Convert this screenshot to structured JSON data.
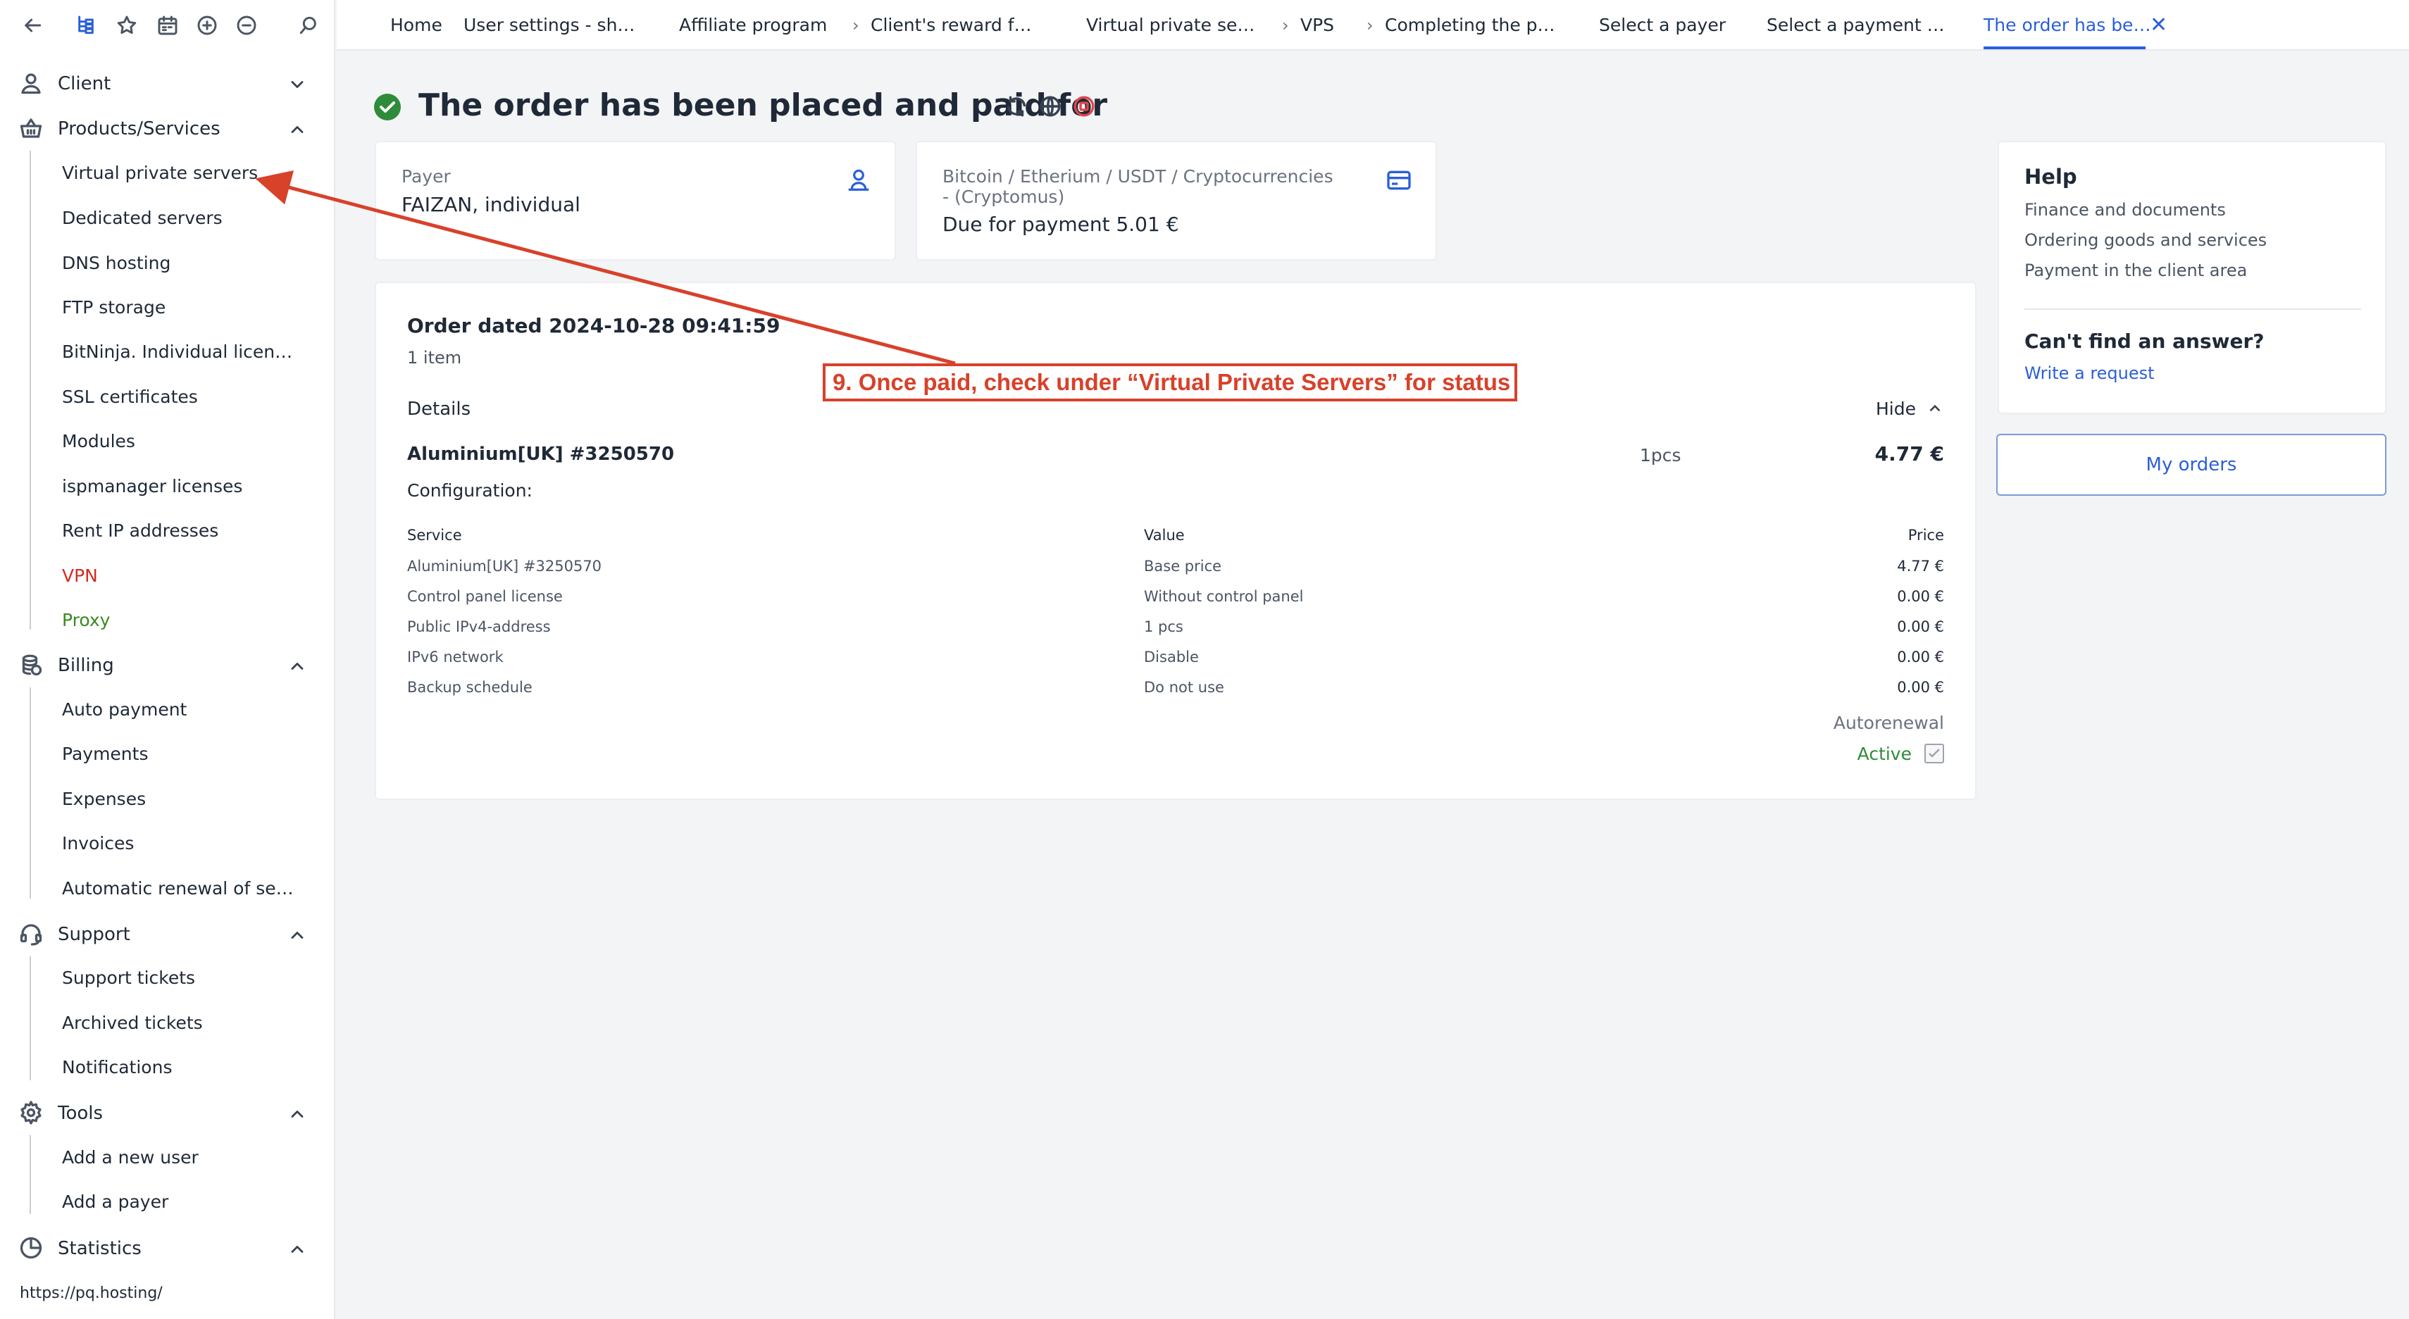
{
  "sidebar": {
    "sections": {
      "client": "Client",
      "products": "Products/Services",
      "billing": "Billing",
      "support": "Support",
      "tools": "Tools",
      "statistics": "Statistics"
    },
    "products_items": [
      "Virtual private servers",
      "Dedicated servers",
      "DNS hosting",
      "FTP storage",
      "BitNinja. Individual licen…",
      "SSL certificates",
      "Modules",
      "ispmanager licenses",
      "Rent IP addresses",
      "VPN",
      "Proxy"
    ],
    "billing_items": [
      "Auto payment",
      "Payments",
      "Expenses",
      "Invoices",
      "Automatic renewal of se…"
    ],
    "support_items": [
      "Support tickets",
      "Archived tickets",
      "Notifications"
    ],
    "tools_items": [
      "Add a new user",
      "Add a payer"
    ]
  },
  "status_url": "https://pq.hosting/",
  "breadcrumbs": [
    "Home",
    "User settings - sh…",
    "Affiliate program",
    "Client's reward f…",
    "Virtual private se…",
    "VPS",
    "Completing the p…",
    "Select a payer",
    "Select a payment …",
    "The order has be…"
  ],
  "page": {
    "title": "The order has been placed and paid for",
    "payer": {
      "label": "Payer",
      "value": "FAIZAN, individual"
    },
    "payment": {
      "method": "Bitcoin / Etherium / USDT / Cryptocurrencies - (Cryptomus)",
      "due": "Due for payment 5.01 €"
    },
    "order": {
      "date": "Order dated 2024-10-28 09:41:59",
      "count": "1 item",
      "details_label": "Details",
      "hide_label": "Hide",
      "product": "Aluminium[UK] #3250570",
      "qty": "1pcs",
      "price": "4.77 €",
      "config_label": "Configuration:",
      "columns": [
        "Service",
        "Value",
        "Price"
      ],
      "rows": [
        [
          "Aluminium[UK] #3250570",
          "Base price",
          "4.77 €"
        ],
        [
          "Control panel license",
          "Without control panel",
          "0.00 €"
        ],
        [
          "Public IPv4-address",
          "1 pcs",
          "0.00 €"
        ],
        [
          "IPv6 network",
          "Disable",
          "0.00 €"
        ],
        [
          "Backup schedule",
          "Do not use",
          "0.00 €"
        ]
      ],
      "autorenewal_label": "Autorenewal",
      "autorenewal_value": "Active"
    }
  },
  "help": {
    "title": "Help",
    "links": [
      "Finance and documents",
      "Ordering goods and services",
      "Payment in the client area"
    ],
    "cant_find": "Can't find an answer?",
    "write_request": "Write a request",
    "my_orders": "My orders"
  },
  "annotation": "9. Once paid, check under “Virtual Private Servers” for status",
  "colors": {
    "accent": "#2b5fd9",
    "success": "#2e8b3a",
    "annotation": "#d8412a",
    "vpn": "#d12c20",
    "proxy": "#3a8a1f"
  }
}
